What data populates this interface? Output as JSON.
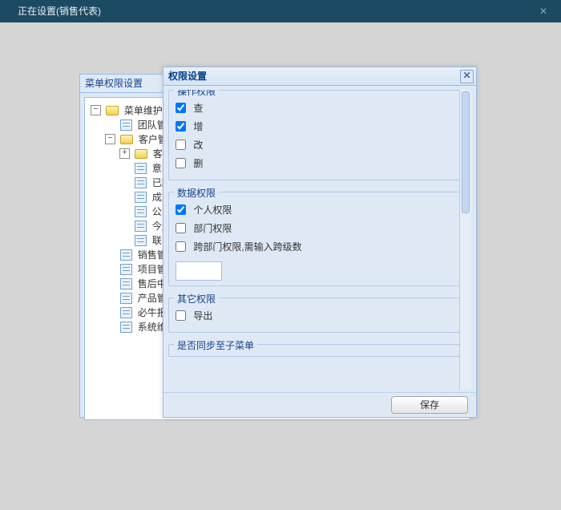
{
  "window": {
    "title": "正在设置(销售代表)"
  },
  "back_panel": {
    "title": "菜单权限设置",
    "tree": {
      "root": {
        "label": "菜单维护"
      },
      "team": {
        "label": "团队管"
      },
      "cust": {
        "label": "客户管"
      },
      "cust_sub": {
        "label": "客户"
      },
      "intent": {
        "label": "意向"
      },
      "tracked": {
        "label": "已跟"
      },
      "deal": {
        "label": "成交"
      },
      "pool": {
        "label": "公海"
      },
      "today": {
        "label": "今天"
      },
      "contact": {
        "label": "联系"
      },
      "sales": {
        "label": "销售管"
      },
      "project": {
        "label": "项目管"
      },
      "after": {
        "label": "售后中"
      },
      "product": {
        "label": "产品管"
      },
      "report": {
        "label": "必牛报"
      },
      "system": {
        "label": "系统维"
      }
    }
  },
  "dialog": {
    "title": "权限设置",
    "op": {
      "legend": "操作权限",
      "view": {
        "label": "查",
        "checked": true
      },
      "add": {
        "label": "增",
        "checked": true
      },
      "edit": {
        "label": "改",
        "checked": false
      },
      "del": {
        "label": "删",
        "checked": false
      }
    },
    "data": {
      "legend": "数据权限",
      "personal": {
        "label": "个人权限",
        "checked": true
      },
      "dept": {
        "label": "部门权限",
        "checked": false
      },
      "cross": {
        "label": "跨部门权限,需输入跨级数",
        "checked": false,
        "value": ""
      }
    },
    "other": {
      "legend": "其它权限",
      "export": {
        "label": "导出",
        "checked": false
      }
    },
    "sync": {
      "legend": "是否同步至子菜单"
    },
    "save": "保存"
  }
}
